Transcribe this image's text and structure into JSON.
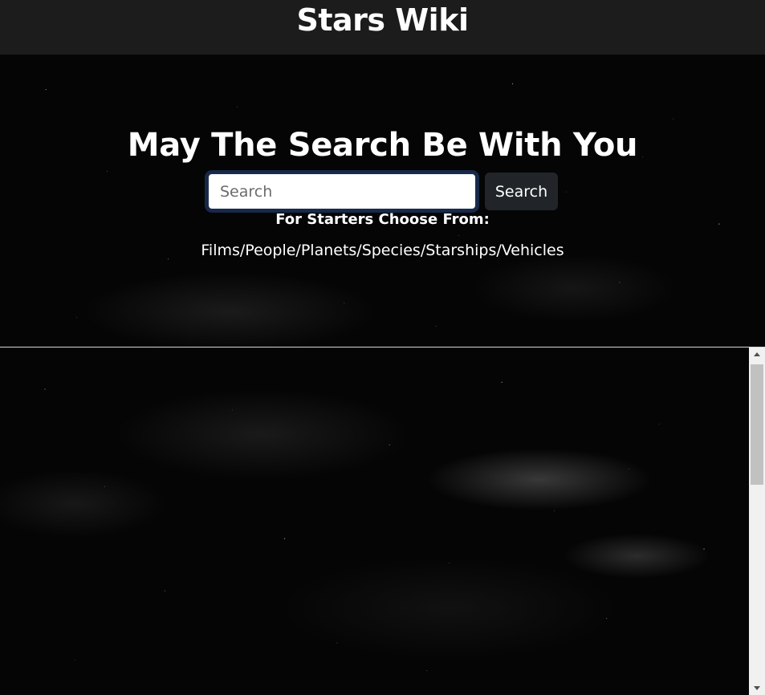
{
  "navbar": {
    "brand": "Stars Wiki"
  },
  "hero": {
    "title": "May The Search Be With You",
    "search": {
      "placeholder": "Search",
      "value": "",
      "button_label": "Search"
    },
    "hint_label": "For Starters Choose From:",
    "categories_text": "Films/People/Planets/Species/Starships/Vehicles"
  },
  "scrollbar": {
    "up_icon": "arrow-up-icon",
    "down_icon": "arrow-down-icon"
  },
  "colors": {
    "navbar_bg": "#1c1c1c",
    "button_bg": "#212529",
    "page_bg": "#000000",
    "text": "#ffffff"
  }
}
